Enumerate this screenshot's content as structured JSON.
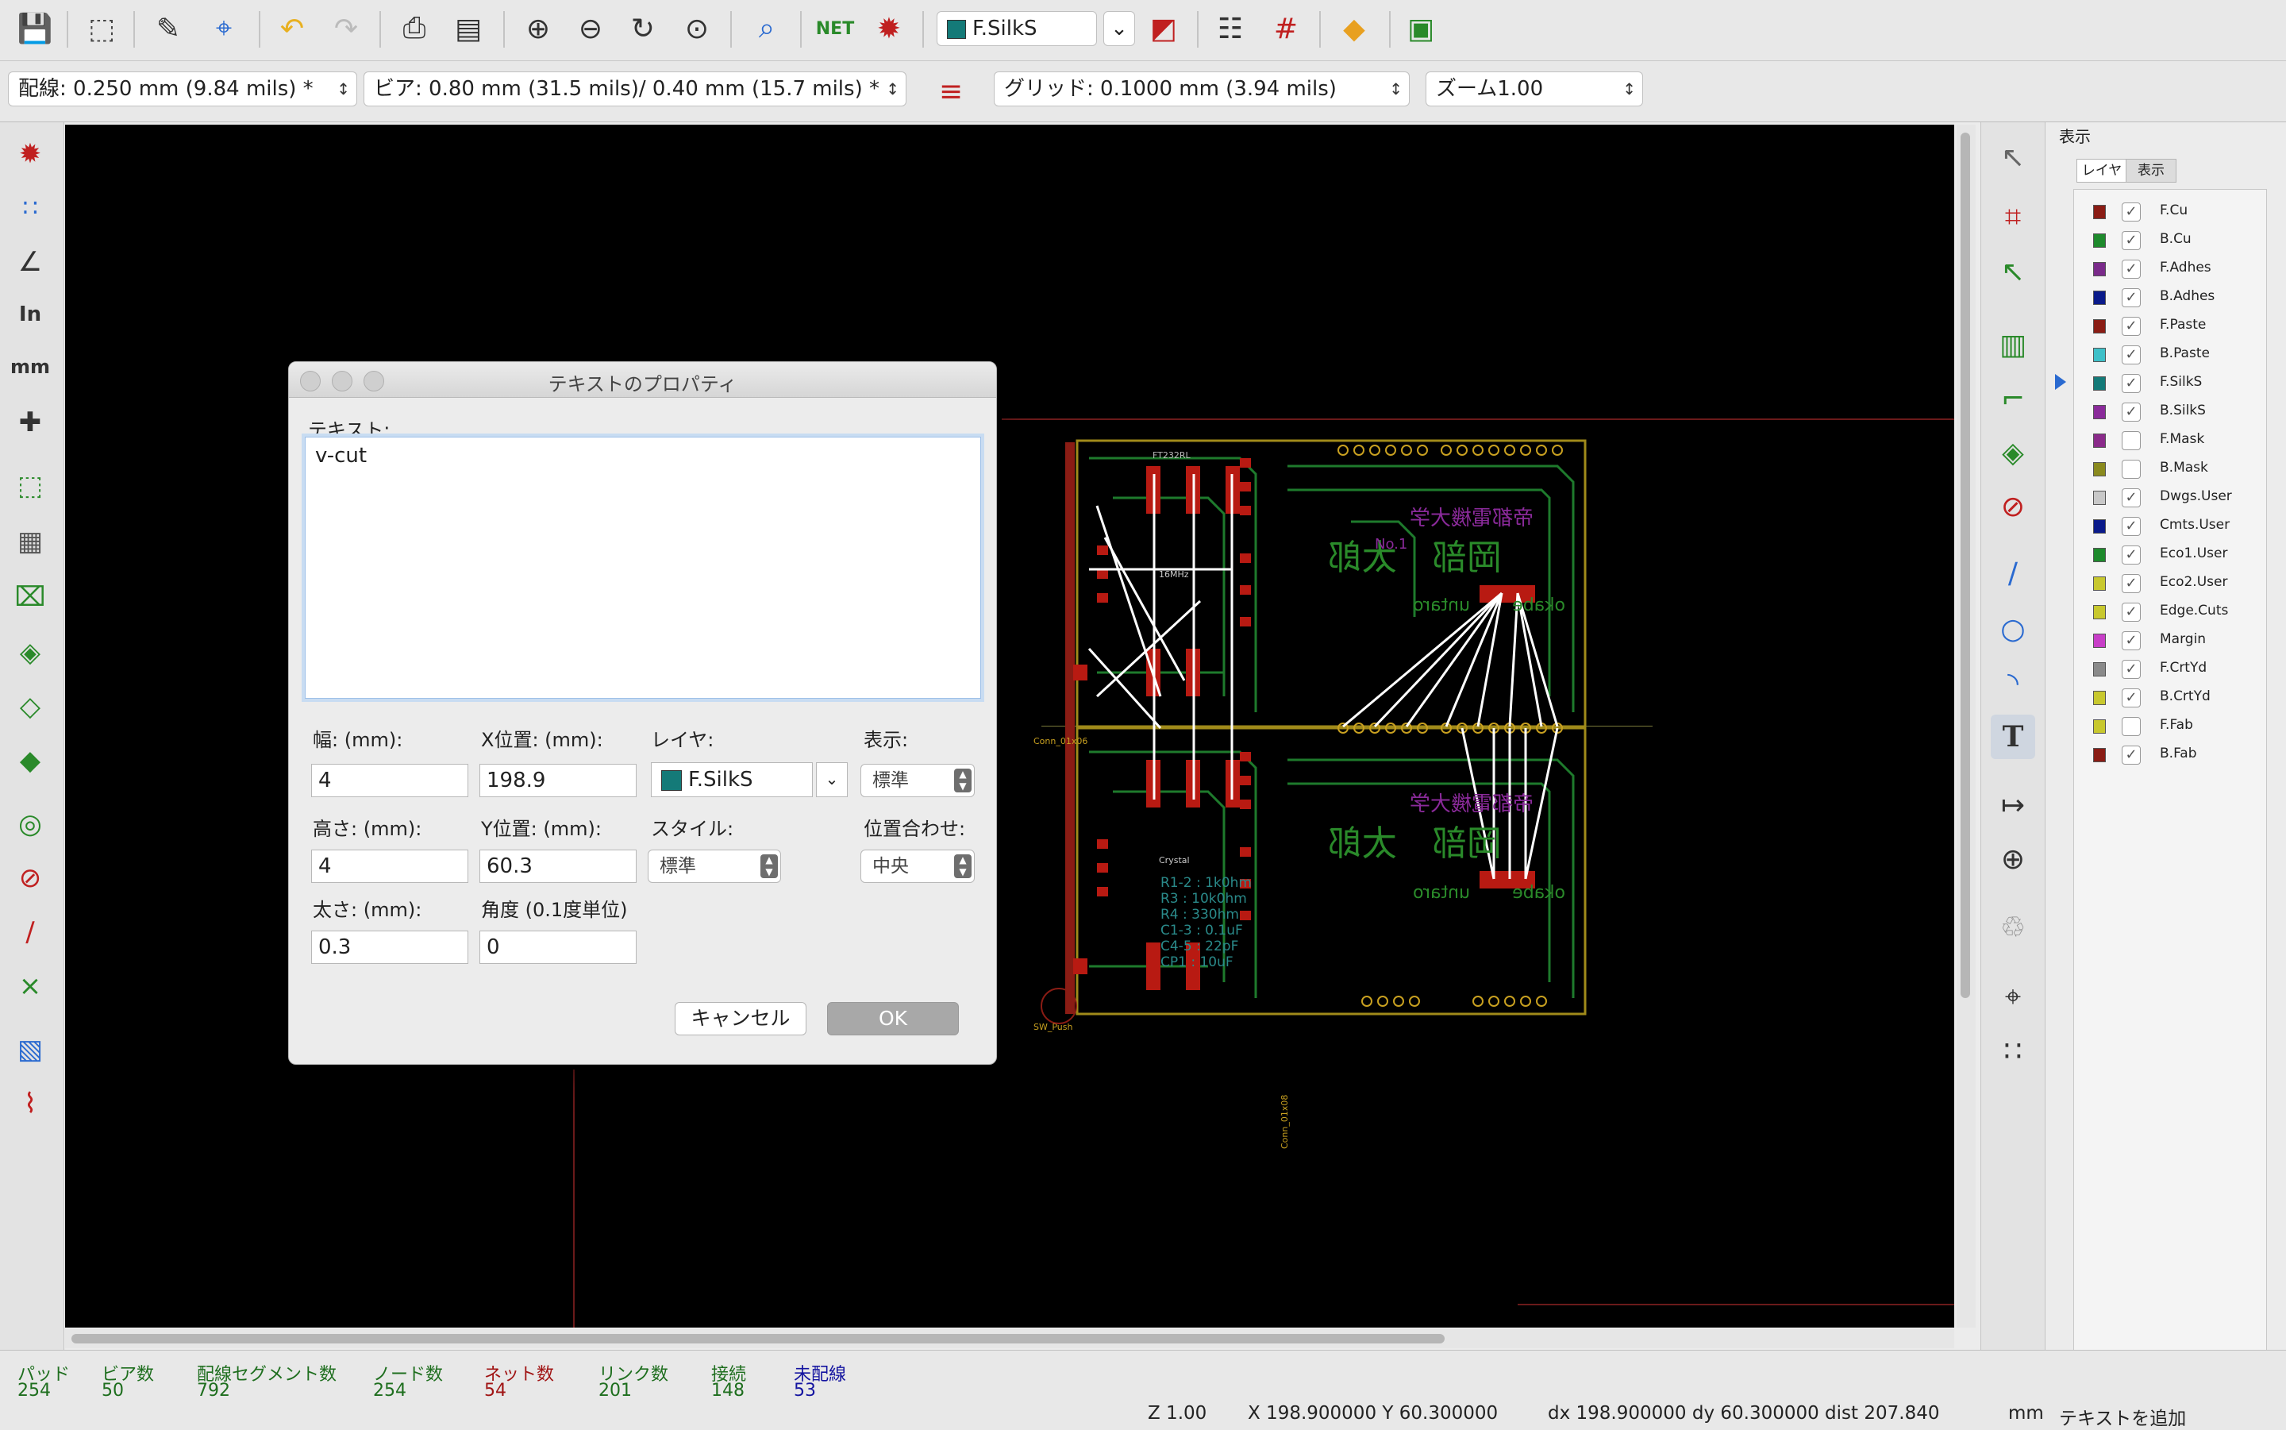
{
  "toolbar": {
    "layer_selector": "F.SilkS",
    "layer_color": "#147a78",
    "icons": [
      "save-icon",
      "page-settings-icon",
      "edit-footprint-icon",
      "footprint-browser-icon",
      "undo-icon",
      "redo-icon",
      "print-icon",
      "plot-icon",
      "zoom-in-icon",
      "zoom-out-icon",
      "refresh-icon",
      "zoom-fit-icon",
      "find-icon",
      "netlist-icon",
      "drc-icon",
      "layer-pair-icon",
      "auto-place-icon",
      "grid-icon",
      "route-icon",
      "scripting-console-icon"
    ]
  },
  "options": {
    "track": "配線: 0.250 mm (9.84 mils) *",
    "via": "ビア: 0.80 mm (31.5 mils)/ 0.40 mm (15.7 mils) *",
    "grid": "グリッド: 0.1000 mm (3.94 mils)",
    "zoom": "ズーム1.00"
  },
  "layers_panel": {
    "title": "表示",
    "tabs": [
      "レイヤ",
      "表示"
    ],
    "active_layer": "F.SilkS",
    "layers": [
      {
        "name": "F.Cu",
        "color": "#8a1c14",
        "checked": true
      },
      {
        "name": "B.Cu",
        "color": "#1e8a2c",
        "checked": true
      },
      {
        "name": "F.Adhes",
        "color": "#7a2a8a",
        "checked": true
      },
      {
        "name": "B.Adhes",
        "color": "#0a1a8a",
        "checked": true
      },
      {
        "name": "F.Paste",
        "color": "#8a1c14",
        "checked": true
      },
      {
        "name": "B.Paste",
        "color": "#3ec0c8",
        "checked": true
      },
      {
        "name": "F.SilkS",
        "color": "#147a78",
        "checked": true
      },
      {
        "name": "B.SilkS",
        "color": "#8a2a9a",
        "checked": true
      },
      {
        "name": "F.Mask",
        "color": "#8a2a8a",
        "checked": false
      },
      {
        "name": "B.Mask",
        "color": "#8a8a1e",
        "checked": false
      },
      {
        "name": "Dwgs.User",
        "color": "#c8c8c8",
        "checked": true
      },
      {
        "name": "Cmts.User",
        "color": "#0a1a8a",
        "checked": true
      },
      {
        "name": "Eco1.User",
        "color": "#1e8a2c",
        "checked": true
      },
      {
        "name": "Eco2.User",
        "color": "#c8c82e",
        "checked": true
      },
      {
        "name": "Edge.Cuts",
        "color": "#c8c82e",
        "checked": true
      },
      {
        "name": "Margin",
        "color": "#c83ec8",
        "checked": true
      },
      {
        "name": "F.CrtYd",
        "color": "#8a8a8a",
        "checked": true
      },
      {
        "name": "B.CrtYd",
        "color": "#c8c82e",
        "checked": true
      },
      {
        "name": "F.Fab",
        "color": "#c8c82e",
        "checked": false
      },
      {
        "name": "B.Fab",
        "color": "#8a1c14",
        "checked": true
      }
    ]
  },
  "dialog": {
    "title": "テキストのプロパティ",
    "text_label": "テキスト:",
    "text_value": "v-cut",
    "width_label": "幅: (mm):",
    "width_value": "4",
    "x_label": "X位置: (mm):",
    "x_value": "198.9",
    "layer_label": "レイヤ:",
    "layer_value": "F.SilkS",
    "display_label": "表示:",
    "display_value": "標準",
    "height_label": "高さ: (mm):",
    "height_value": "4",
    "y_label": "Y位置: (mm):",
    "y_value": "60.3",
    "style_label": "スタイル:",
    "style_value": "標準",
    "justify_label": "位置合わせ:",
    "justify_value": "中央",
    "thickness_label": "太さ: (mm):",
    "thickness_value": "0.3",
    "angle_label": "角度 (0.1度単位)",
    "angle_value": "0",
    "cancel": "キャンセル",
    "ok": "OK"
  },
  "board": {
    "silk_texts": [
      "帝都電機大学",
      "No.1",
      "岡部　太郎",
      "okabe",
      "untaro",
      "Conn_01x06",
      "Conn_01x08",
      "FT232RL",
      "16MHz",
      "Crystal",
      "C1-3 : 0.1uF",
      "C4-5 : 22pF",
      "CP1 : 10uF",
      "R1-2 : 1k0hm",
      "R3 : 10k0hm",
      "R4 : 330hm",
      "SW_Push"
    ]
  },
  "status": {
    "items": [
      {
        "label": "パッド",
        "value": "254",
        "color": "#1e6e1e"
      },
      {
        "label": "ビア数",
        "value": "50",
        "color": "#1e6e1e"
      },
      {
        "label": "配線セグメント数",
        "value": "792",
        "color": "#1e6e1e"
      },
      {
        "label": "ノード数",
        "value": "254",
        "color": "#1e6e1e"
      },
      {
        "label": "ネット数",
        "value": "54",
        "color": "#a01414"
      },
      {
        "label": "リンク数",
        "value": "201",
        "color": "#1e6e1e"
      },
      {
        "label": "接続",
        "value": "148",
        "color": "#1e6e1e"
      },
      {
        "label": "未配線",
        "value": "53",
        "color": "#1414a0"
      }
    ],
    "zoom": "Z 1.00",
    "xy": "X 198.900000  Y 60.300000",
    "delta": "dx 198.900000  dy 60.300000  dist 207.840",
    "units": "mm",
    "message": "テキストを追加"
  }
}
